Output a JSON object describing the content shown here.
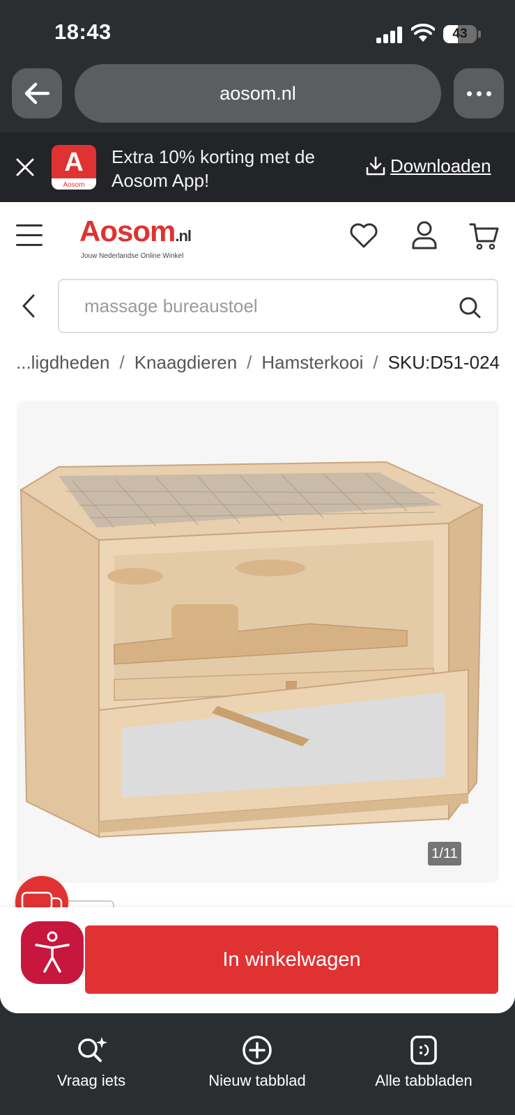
{
  "status_bar": {
    "time": "18:43",
    "battery": "43",
    "battery_level": 0.43
  },
  "browser": {
    "url": "aosom.nl"
  },
  "app_banner": {
    "app_icon_letter": "A",
    "app_icon_label": "Aosom",
    "text": "Extra 10% korting met de Aosom App!",
    "download_label": "Downloaden"
  },
  "site": {
    "logo_main": "Aosom",
    "logo_tld": ".nl",
    "tagline": "Jouw Nederlandse Online Winkel",
    "accent_color": "#e03233"
  },
  "search": {
    "placeholder": "massage bureaustoel"
  },
  "breadcrumb": {
    "items": [
      "...ligdheden",
      "Knaagdieren",
      "Hamsterkooi"
    ],
    "current": "SKU:D51-024"
  },
  "product": {
    "image_counter": "1/11",
    "add_to_cart_label": "In winkelwagen"
  },
  "safari_bottom": {
    "items": [
      {
        "label": "Vraag iets",
        "icon": "search-sparkle-icon"
      },
      {
        "label": "Nieuw tabblad",
        "icon": "plus-circle-icon"
      },
      {
        "label": "Alle tabbladen",
        "icon": "tabs-icon"
      }
    ]
  }
}
